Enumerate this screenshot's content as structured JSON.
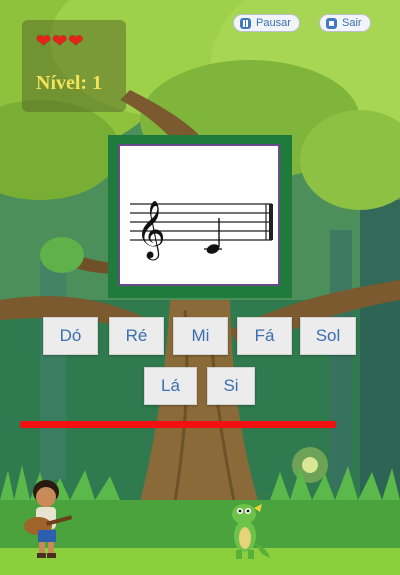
{
  "hud": {
    "lives": [
      "❤",
      "❤",
      "❤"
    ],
    "level_label": "Nível: 1"
  },
  "buttons": {
    "pause_label": "Pausar",
    "exit_label": "Sair"
  },
  "staff": {
    "clef": "treble",
    "note": "Dó"
  },
  "answers": {
    "row1": [
      "Dó",
      "Ré",
      "Mi",
      "Fá",
      "Sol"
    ],
    "row2": [
      "Lá",
      "Si"
    ]
  },
  "timer": {
    "remaining_fraction": 0.79
  },
  "icons": {
    "pause": "pause-icon",
    "exit": "stop-icon",
    "heart": "heart-icon"
  },
  "colors": {
    "hud_level": "#f3e35a",
    "heart": "#e8211b",
    "card_border": "#1f7a3c",
    "answer_text": "#3d6eb0",
    "timer_bar": "#f21010"
  }
}
